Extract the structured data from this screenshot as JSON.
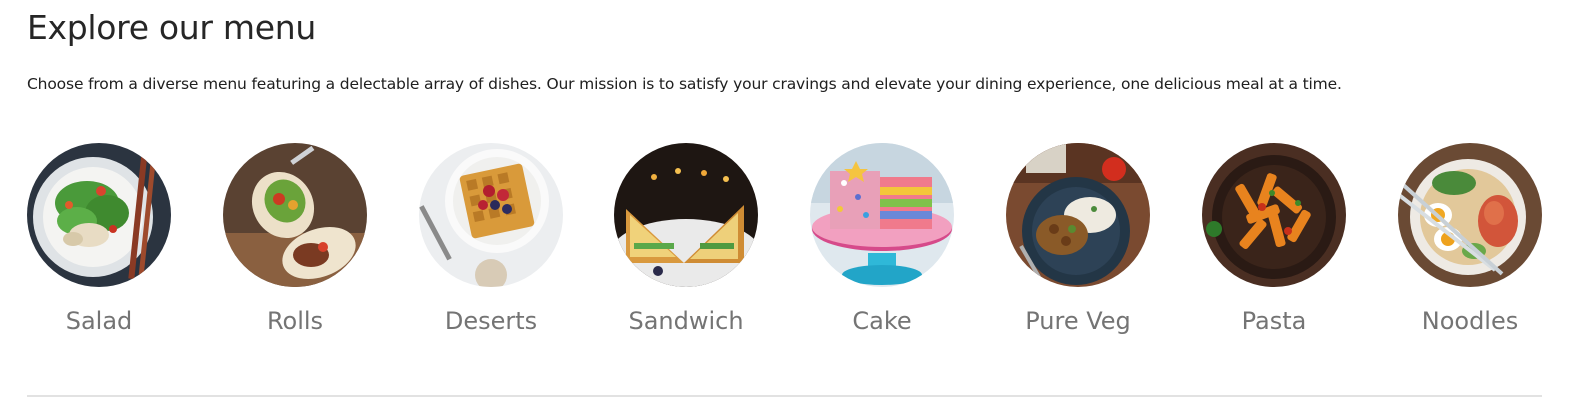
{
  "section": {
    "title": "Explore our menu",
    "description": "Choose from a diverse menu featuring a delectable array of dishes. Our mission is to satisfy your cravings and elevate your dining experience, one delicious meal at a time."
  },
  "menu": {
    "items": [
      {
        "label": "Salad",
        "image": "salad-photo"
      },
      {
        "label": "Rolls",
        "image": "rolls-photo"
      },
      {
        "label": "Deserts",
        "image": "deserts-photo"
      },
      {
        "label": "Sandwich",
        "image": "sandwich-photo"
      },
      {
        "label": "Cake",
        "image": "cake-photo"
      },
      {
        "label": "Pure Veg",
        "image": "pure-veg-photo"
      },
      {
        "label": "Pasta",
        "image": "pasta-photo"
      },
      {
        "label": "Noodles",
        "image": "noodles-photo"
      }
    ]
  },
  "colors": {
    "title": "#262626",
    "label": "#747474",
    "divider": "#e2e2e2"
  }
}
